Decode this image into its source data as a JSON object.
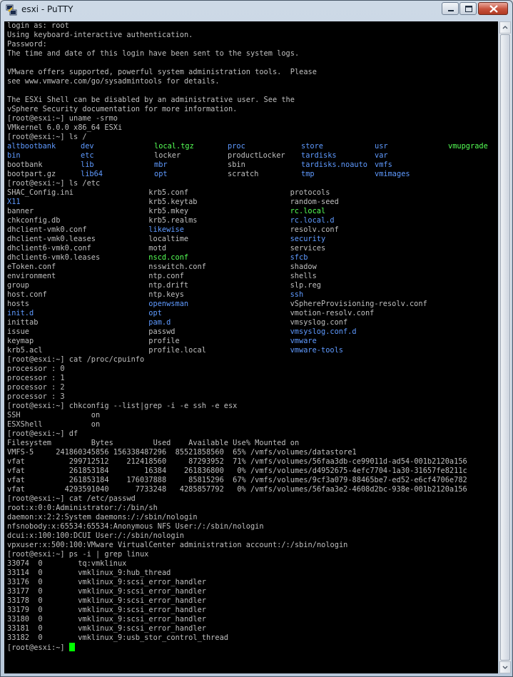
{
  "window": {
    "title": "esxi - PuTTY",
    "icon": "putty-icon"
  },
  "terminal": {
    "lines": [
      [
        {
          "t": "login as: root"
        }
      ],
      [
        {
          "t": "Using keyboard-interactive authentication."
        }
      ],
      [
        {
          "t": "Password:"
        }
      ],
      [
        {
          "t": "The time and date of this login have been sent to the system logs."
        }
      ],
      [
        {
          "t": ""
        }
      ],
      [
        {
          "t": "VMware offers supported, powerful system administration tools.  Please"
        }
      ],
      [
        {
          "t": "see www.vmware.com/go/sysadmintools for details."
        }
      ],
      [
        {
          "t": ""
        }
      ],
      [
        {
          "t": "The ESXi Shell can be disabled by an administrative user. See the"
        }
      ],
      [
        {
          "t": "vSphere Security documentation for more information."
        }
      ],
      [
        {
          "t": "[root@esxi:~] uname -srmo"
        }
      ],
      [
        {
          "t": "VMkernel 6.0.0 x86_64 ESXi"
        }
      ],
      [
        {
          "t": "[root@esxi:~] ls /"
        }
      ],
      [
        {
          "t": "altbootbank",
          "c": "cyan",
          "w": 13
        },
        {
          "t": "dev",
          "c": "cyan",
          "w": 13
        },
        {
          "t": "local.tgz",
          "c": "green",
          "w": 13
        },
        {
          "t": "proc",
          "c": "cyan",
          "w": 13
        },
        {
          "t": "store",
          "c": "cyan",
          "w": 13
        },
        {
          "t": "usr",
          "c": "cyan",
          "w": 13
        },
        {
          "t": "vmupgrade",
          "c": "green"
        }
      ],
      [
        {
          "t": "bin",
          "c": "cyan",
          "w": 13
        },
        {
          "t": "etc",
          "c": "cyan",
          "w": 13
        },
        {
          "t": "locker",
          "w": 13
        },
        {
          "t": "productLocker",
          "w": 13
        },
        {
          "t": "tardisks",
          "c": "cyan",
          "w": 13
        },
        {
          "t": "var",
          "c": "cyan"
        }
      ],
      [
        {
          "t": "bootbank",
          "w": 13
        },
        {
          "t": "lib",
          "c": "cyan",
          "w": 13
        },
        {
          "t": "mbr",
          "c": "cyan",
          "w": 13
        },
        {
          "t": "sbin",
          "w": 13
        },
        {
          "t": "tardisks.noauto",
          "c": "cyan",
          "w": 13
        },
        {
          "t": "vmfs",
          "c": "cyan"
        }
      ],
      [
        {
          "t": "bootpart.gz",
          "w": 13
        },
        {
          "t": "lib64",
          "c": "cyan",
          "w": 13
        },
        {
          "t": "opt",
          "c": "cyan",
          "w": 13
        },
        {
          "t": "scratch",
          "w": 13
        },
        {
          "t": "tmp",
          "c": "cyan",
          "w": 13
        },
        {
          "t": "vmimages",
          "c": "cyan"
        }
      ],
      [
        {
          "t": "[root@esxi:~] ls /etc"
        }
      ],
      [
        {
          "t": "SHAC_Config.ini",
          "w": 25
        },
        {
          "t": "krb5.conf",
          "w": 25
        },
        {
          "t": "protocols"
        }
      ],
      [
        {
          "t": "X11",
          "c": "cyan",
          "w": 25
        },
        {
          "t": "krb5.keytab",
          "w": 25
        },
        {
          "t": "random-seed"
        }
      ],
      [
        {
          "t": "banner",
          "w": 25
        },
        {
          "t": "krb5.mkey",
          "w": 25
        },
        {
          "t": "rc.local",
          "c": "green"
        }
      ],
      [
        {
          "t": "chkconfig.db",
          "w": 25
        },
        {
          "t": "krb5.realms",
          "w": 25
        },
        {
          "t": "rc.local.d",
          "c": "cyan"
        }
      ],
      [
        {
          "t": "dhclient-vmk0.conf",
          "w": 25
        },
        {
          "t": "likewise",
          "c": "cyan",
          "w": 25
        },
        {
          "t": "resolv.conf"
        }
      ],
      [
        {
          "t": "dhclient-vmk0.leases",
          "w": 25
        },
        {
          "t": "localtime",
          "w": 25
        },
        {
          "t": "security",
          "c": "cyan"
        }
      ],
      [
        {
          "t": "dhclient6-vmk0.conf",
          "w": 25
        },
        {
          "t": "motd",
          "w": 25
        },
        {
          "t": "services"
        }
      ],
      [
        {
          "t": "dhclient6-vmk0.leases",
          "w": 25
        },
        {
          "t": "nscd.conf",
          "c": "green",
          "w": 25
        },
        {
          "t": "sfcb",
          "c": "cyan"
        }
      ],
      [
        {
          "t": "eToken.conf",
          "w": 25
        },
        {
          "t": "nsswitch.conf",
          "w": 25
        },
        {
          "t": "shadow"
        }
      ],
      [
        {
          "t": "environment",
          "w": 25
        },
        {
          "t": "ntp.conf",
          "w": 25
        },
        {
          "t": "shells"
        }
      ],
      [
        {
          "t": "group",
          "w": 25
        },
        {
          "t": "ntp.drift",
          "w": 25
        },
        {
          "t": "slp.reg"
        }
      ],
      [
        {
          "t": "host.conf",
          "w": 25
        },
        {
          "t": "ntp.keys",
          "w": 25
        },
        {
          "t": "ssh",
          "c": "cyan"
        }
      ],
      [
        {
          "t": "hosts",
          "w": 25
        },
        {
          "t": "openwsman",
          "c": "cyan",
          "w": 25
        },
        {
          "t": "vSphereProvisioning-resolv.conf"
        }
      ],
      [
        {
          "t": "init.d",
          "c": "cyan",
          "w": 25
        },
        {
          "t": "opt",
          "c": "cyan",
          "w": 25
        },
        {
          "t": "vmotion-resolv.conf"
        }
      ],
      [
        {
          "t": "inittab",
          "w": 25
        },
        {
          "t": "pam.d",
          "c": "cyan",
          "w": 25
        },
        {
          "t": "vmsyslog.conf"
        }
      ],
      [
        {
          "t": "issue",
          "w": 25
        },
        {
          "t": "passwd",
          "w": 25
        },
        {
          "t": "vmsyslog.conf.d",
          "c": "cyan"
        }
      ],
      [
        {
          "t": "keymap",
          "w": 25
        },
        {
          "t": "profile",
          "w": 25
        },
        {
          "t": "vmware",
          "c": "cyan"
        }
      ],
      [
        {
          "t": "krb5.acl",
          "w": 25
        },
        {
          "t": "profile.local",
          "w": 25
        },
        {
          "t": "vmware-tools",
          "c": "cyan"
        }
      ],
      [
        {
          "t": "[root@esxi:~] cat /proc/cpuinfo"
        }
      ],
      [
        {
          "t": "processor : 0"
        }
      ],
      [
        {
          "t": "processor : 1"
        }
      ],
      [
        {
          "t": "processor : 2"
        }
      ],
      [
        {
          "t": "processor : 3"
        }
      ],
      [
        {
          "t": "[root@esxi:~] chkconfig --list|grep -i -e ssh -e esx"
        }
      ],
      [
        {
          "t": "SSH                on"
        }
      ],
      [
        {
          "t": "ESXShell           on"
        }
      ],
      [
        {
          "t": "[root@esxi:~] df"
        }
      ],
      [
        {
          "t": "Filesystem         Bytes         Used    Available Use% Mounted on"
        }
      ],
      [
        {
          "t": "VMFS-5     241860345856 156338487296  85521858560  65% /vmfs/volumes/datastore1"
        }
      ],
      [
        {
          "t": "vfat          299712512    212418560     87293952  71% /vmfs/volumes/56faa3db-ce99011d-ad54-001b2120a156"
        }
      ],
      [
        {
          "t": "vfat          261853184        16384    261836800   0% /vmfs/volumes/d4952675-4efc7704-1a30-31657fe8211c"
        }
      ],
      [
        {
          "t": "vfat          261853184    176037888     85815296  67% /vmfs/volumes/9cf3a079-88465be7-ed52-e6cf4706e782"
        }
      ],
      [
        {
          "t": "vfat         4293591040      7733248   4285857792   0% /vmfs/volumes/56faa3e2-4608d2bc-938e-001b2120a156"
        }
      ],
      [
        {
          "t": "[root@esxi:~] cat /etc/passwd"
        }
      ],
      [
        {
          "t": "root:x:0:0:Administrator:/:/bin/sh"
        }
      ],
      [
        {
          "t": "daemon:x:2:2:System daemons:/:/sbin/nologin"
        }
      ],
      [
        {
          "t": "nfsnobody:x:65534:65534:Anonymous NFS User:/:/sbin/nologin"
        }
      ],
      [
        {
          "t": "dcui:x:100:100:DCUI User:/:/sbin/nologin"
        }
      ],
      [
        {
          "t": "vpxuser:x:500:100:VMware VirtualCenter administration account:/:/sbin/nologin"
        }
      ],
      [
        {
          "t": "[root@esxi:~] ps -i | grep linux"
        }
      ],
      [
        {
          "t": "33074  0        tq:vmklinux"
        }
      ],
      [
        {
          "t": "33114  0        vmklinux_9:hub_thread"
        }
      ],
      [
        {
          "t": "33176  0        vmklinux_9:scsi_error_handler"
        }
      ],
      [
        {
          "t": "33177  0        vmklinux_9:scsi_error_handler"
        }
      ],
      [
        {
          "t": "33178  0        vmklinux_9:scsi_error_handler"
        }
      ],
      [
        {
          "t": "33179  0        vmklinux_9:scsi_error_handler"
        }
      ],
      [
        {
          "t": "33180  0        vmklinux_9:scsi_error_handler"
        }
      ],
      [
        {
          "t": "33181  0        vmklinux_9:scsi_error_handler"
        }
      ],
      [
        {
          "t": "33182  0        vmklinux_9:usb_stor_control_thread"
        }
      ]
    ],
    "prompt": "[root@esxi:~] "
  },
  "colors": {
    "cyan": "#5f9aff",
    "green": "#55ff55",
    "cursor": "#00ff00",
    "text": "#bfbfbf",
    "background": "#000000"
  }
}
